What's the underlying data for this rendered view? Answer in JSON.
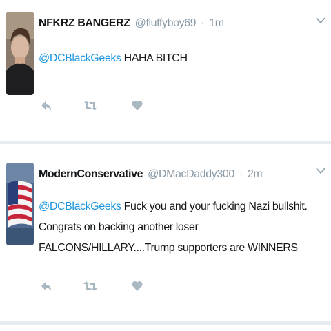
{
  "tweets": [
    {
      "display_name": "NFKRZ BANGERZ",
      "handle": "@fluffyboy69",
      "separator": "·",
      "time": "1m",
      "mention": "@DCBlackGeeks",
      "text": " HAHA BITCH",
      "avatar_icon": "person-photo-icon"
    },
    {
      "display_name": "ModernConservative",
      "handle": "@DMacDaddy300",
      "separator": "·",
      "time": "2m",
      "mention": "@DCBlackGeeks",
      "text": " Fuck you and your fucking Nazi bullshit.  Congrats on backing another loser FALCONS/HILLARY....Trump supporters are WINNERS",
      "avatar_icon": "american-flag-icon"
    }
  ],
  "actions": {
    "reply_icon": "reply-icon",
    "retweet_icon": "retweet-icon",
    "like_icon": "heart-icon",
    "more_icon": "chevron-down-icon"
  },
  "colors": {
    "link": "#1b95e0",
    "muted": "#8899a6",
    "icon": "#aab8c2",
    "separator": "#e6ecf0"
  }
}
